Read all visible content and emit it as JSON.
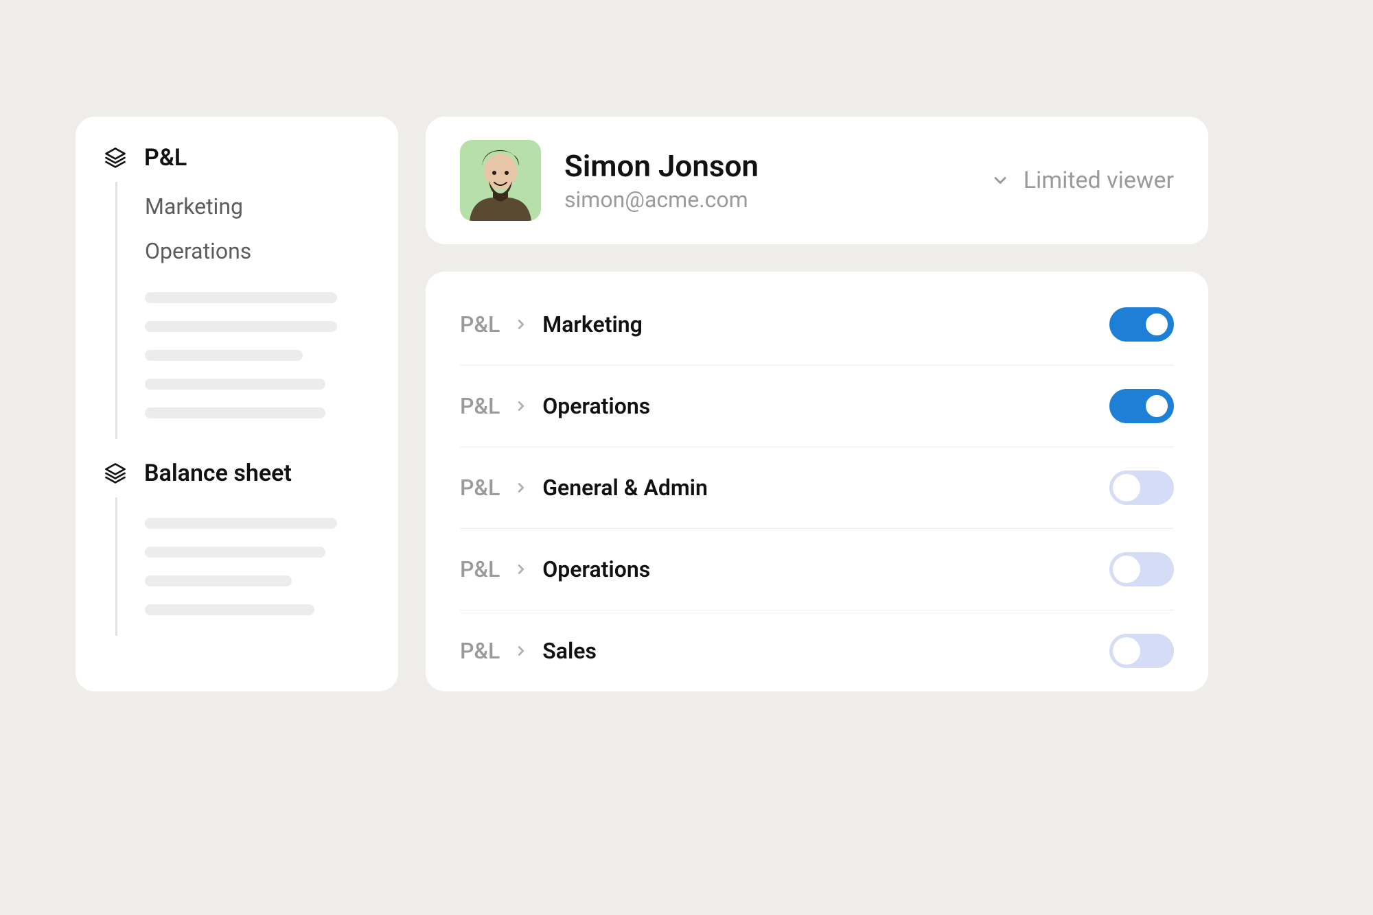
{
  "colors": {
    "background": "#efede9",
    "card": "#ffffff",
    "toggle_on": "#1e7fd6",
    "toggle_off": "#d4dcf6"
  },
  "sidebar": {
    "sections": [
      {
        "title": "P&L",
        "children": [
          "Marketing",
          "Operations"
        ],
        "skeleton_rows": 5
      },
      {
        "title": "Balance sheet",
        "children": [],
        "skeleton_rows": 4
      }
    ]
  },
  "user": {
    "name": "Simon Jonson",
    "email": "simon@acme.com",
    "role_label": "Limited viewer"
  },
  "permissions": [
    {
      "root": "P&L",
      "leaf": "Marketing",
      "enabled": true
    },
    {
      "root": "P&L",
      "leaf": "Operations",
      "enabled": true
    },
    {
      "root": "P&L",
      "leaf": "General & Admin",
      "enabled": false
    },
    {
      "root": "P&L",
      "leaf": "Operations",
      "enabled": false
    },
    {
      "root": "P&L",
      "leaf": "Sales",
      "enabled": false
    }
  ]
}
